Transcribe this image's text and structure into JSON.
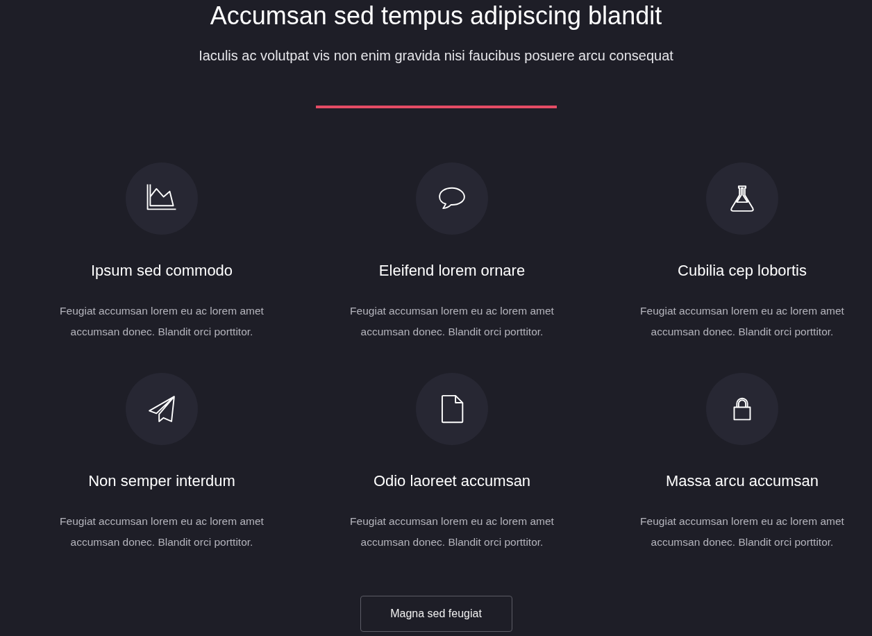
{
  "header": {
    "title": "Accumsan sed tempus adipiscing blandit",
    "subtitle": "Iaculis ac volutpat vis non enim gravida nisi faucibus posuere arcu consequat"
  },
  "features": [
    {
      "kind": "chart",
      "title": "Ipsum sed commodo",
      "text": "Feugiat accumsan lorem eu ac lorem amet accumsan donec. Blandit orci porttitor."
    },
    {
      "kind": "comment",
      "title": "Eleifend lorem ornare",
      "text": "Feugiat accumsan lorem eu ac lorem amet accumsan donec. Blandit orci porttitor."
    },
    {
      "kind": "flask",
      "title": "Cubilia cep lobortis",
      "text": "Feugiat accumsan lorem eu ac lorem amet accumsan donec. Blandit orci porttitor."
    },
    {
      "kind": "plane",
      "title": "Non semper interdum",
      "text": "Feugiat accumsan lorem eu ac lorem amet accumsan donec. Blandit orci porttitor."
    },
    {
      "kind": "file",
      "title": "Odio laoreet accumsan",
      "text": "Feugiat accumsan lorem eu ac lorem amet accumsan donec. Blandit orci porttitor."
    },
    {
      "kind": "lock",
      "title": "Massa arcu accumsan",
      "text": "Feugiat accumsan lorem eu ac lorem amet accumsan donec. Blandit orci porttitor."
    }
  ],
  "button": "Magna sed feugiat"
}
